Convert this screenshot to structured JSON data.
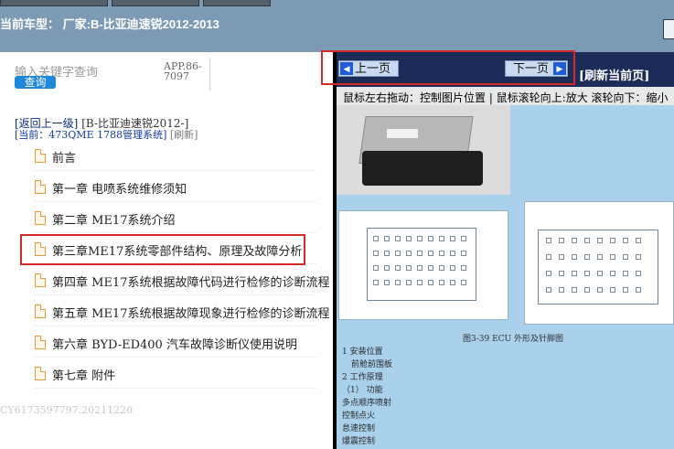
{
  "header": {
    "vehicle_prefix": "当前车型：",
    "vehicle_text": "厂家:B-比亚迪速锐2012-2013"
  },
  "search": {
    "placeholder": "输入关键字查询",
    "query_label": "查询",
    "app_code": "APP.86-7097"
  },
  "nav": {
    "back_label": "[返回上一级]",
    "back_path": "[B-比亚迪速锐2012-]",
    "current_prefix": "[当前：",
    "current_value": "473QME 1788管理系统]",
    "refresh_label": "[刷新]"
  },
  "menu": {
    "items": [
      {
        "label": "前言"
      },
      {
        "label": "第一章 电喷系统维修须知"
      },
      {
        "label": "第二章 ME17系统介绍"
      },
      {
        "label": "第三章ME17系统零部件结构、原理及故障分析"
      },
      {
        "label": "第四章 ME17系统根据故障代码进行检修的诊断流程"
      },
      {
        "label": "第五章 ME17系统根据故障现象进行检修的诊断流程"
      },
      {
        "label": "第六章 BYD-ED400 汽车故障诊断仪使用说明"
      },
      {
        "label": "第七章 附件"
      }
    ],
    "selected_index": 3
  },
  "footer": {
    "id": "CY6173597797.20211220"
  },
  "viewer": {
    "prev_label": "上一页",
    "next_label": "下一页",
    "refresh_home_label": "[刷新当前页]",
    "hint": "鼠标左右拖动：控制图片位置 | 鼠标滚轮向上:放大  滚轮向下：缩小"
  },
  "document": {
    "caption": "图3-39 ECU 外形及针脚图",
    "lines": [
      "1 安装位置",
      "前舱前围板",
      "2 工作原理",
      "（1） 功能",
      "多点顺序喷射",
      "控制点火",
      "怠速控制",
      "爆震控制"
    ]
  },
  "colors": {
    "header_bg": "#7d9ab4",
    "pager_bg": "#1c2c58",
    "highlight": "#d52a2a",
    "doc_bg": "#a9d1ec",
    "query_btn": "#1f88d8"
  }
}
